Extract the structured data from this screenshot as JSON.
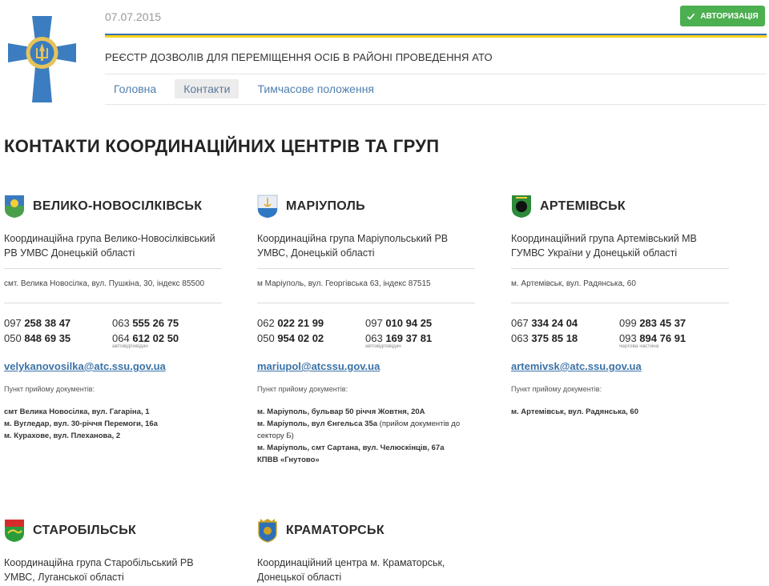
{
  "header": {
    "date": "07.07.2015",
    "auth_label": "АВТОРИЗАЦІЯ",
    "site_title": "РЕЄСТР ДОЗВОЛІВ ДЛЯ ПЕРЕМІЩЕННЯ ОСІБ В РАЙОНІ ПРОВЕДЕННЯ АТО",
    "nav": [
      "Головна",
      "Контакти",
      "Тимчасове положення"
    ],
    "active_nav": "Контакти",
    "colors": {
      "flag_blue": "#3b6fb6",
      "flag_yellow": "#f6d21d",
      "auth_green": "#4caf50"
    }
  },
  "page_title": "КОНТАКТИ КООРДИНАЦІЙНИХ ЦЕНТРІВ ТА ГРУП",
  "centers": [
    {
      "city": "ВЕЛИКО-НОВОСІЛКІВСЬК",
      "emblem": "velyka-novosilka-emblem",
      "group": "Координаційна група Велико-Новосілківський РВ УМВС Донецькій області",
      "address": "смт. Велика Новосілка, вул. Пушкіна, 30, індекс 85500",
      "phones": [
        {
          "prefix": "097",
          "number": "258 38 47",
          "note": ""
        },
        {
          "prefix": "063",
          "number": "555 26 75",
          "note": ""
        },
        {
          "prefix": "050",
          "number": "848 69 35",
          "note": ""
        },
        {
          "prefix": "064",
          "number": "612 02 50",
          "note": "автовідповідач"
        }
      ],
      "email": "velykanovosilka@atc.ssu.gov.ua",
      "reception_label": "Пункт прийому документів:",
      "reception": [
        {
          "bold": "смт Велика Новосілка, вул. Гагаріна, 1",
          "rest": ""
        },
        {
          "bold": "м. Вугледар, вул. 30-річчя Перемоги, 16а",
          "rest": ""
        },
        {
          "bold": "м. Курахове, вул. Плеханова, 2",
          "rest": ""
        }
      ]
    },
    {
      "city": "МАРІУПОЛЬ",
      "emblem": "mariupol-emblem",
      "group": "Координаційна група Маріупольський РВ УМВС, Донецькій області",
      "address": "м Маріуполь, вул. Георгівська 63, індекс 87515",
      "phones": [
        {
          "prefix": "062",
          "number": "022 21 99",
          "note": ""
        },
        {
          "prefix": "097",
          "number": "010 94 25",
          "note": ""
        },
        {
          "prefix": "050",
          "number": "954 02 02",
          "note": ""
        },
        {
          "prefix": "063",
          "number": "169 37 81",
          "note": "автовідповідач"
        }
      ],
      "email": "mariupol@atcssu.gov.ua",
      "reception_label": "Пункт прийому документів:",
      "reception": [
        {
          "bold": "м. Маріуполь, бульвар 50 річчя Жовтня, 20А",
          "rest": ""
        },
        {
          "bold": "м. Маріуполь, вул Єнгельса 35а",
          "rest": " (прийом документів до сектору Б)"
        },
        {
          "bold": "м. Маріуполь, смт Сартана, вул. Челюскінців, 67а",
          "rest": ""
        },
        {
          "bold": "КПВВ «Гнутово»",
          "rest": ""
        }
      ]
    },
    {
      "city": "АРТЕМІВСЬК",
      "emblem": "artemivsk-emblem",
      "group": "Координаційний група Артемівський МВ ГУМВС України у Донецькій області",
      "address": "м. Артемівськ, вул. Радянська, 60",
      "phones": [
        {
          "prefix": "067",
          "number": "334 24 04",
          "note": ""
        },
        {
          "prefix": "099",
          "number": "283 45 37",
          "note": ""
        },
        {
          "prefix": "063",
          "number": "375 85 18",
          "note": ""
        },
        {
          "prefix": "093",
          "number": "894 76 91",
          "note": "чергова частина"
        }
      ],
      "email": "artemivsk@atc.ssu.gov.ua",
      "reception_label": "Пункт прийому документів:",
      "reception": [
        {
          "bold": "м. Артемівськ, вул. Радянська, 60",
          "rest": ""
        }
      ]
    },
    {
      "city": "СТАРОБІЛЬСЬК",
      "emblem": "starobilsk-emblem",
      "group": "Координаційна група Старобільський РВ УМВС, Луганської області"
    },
    {
      "city": "КРАМАТОРСЬК",
      "emblem": "kramatorsk-emblem",
      "group": "Координаційний центра м. Краматорськ, Донецької області"
    }
  ]
}
